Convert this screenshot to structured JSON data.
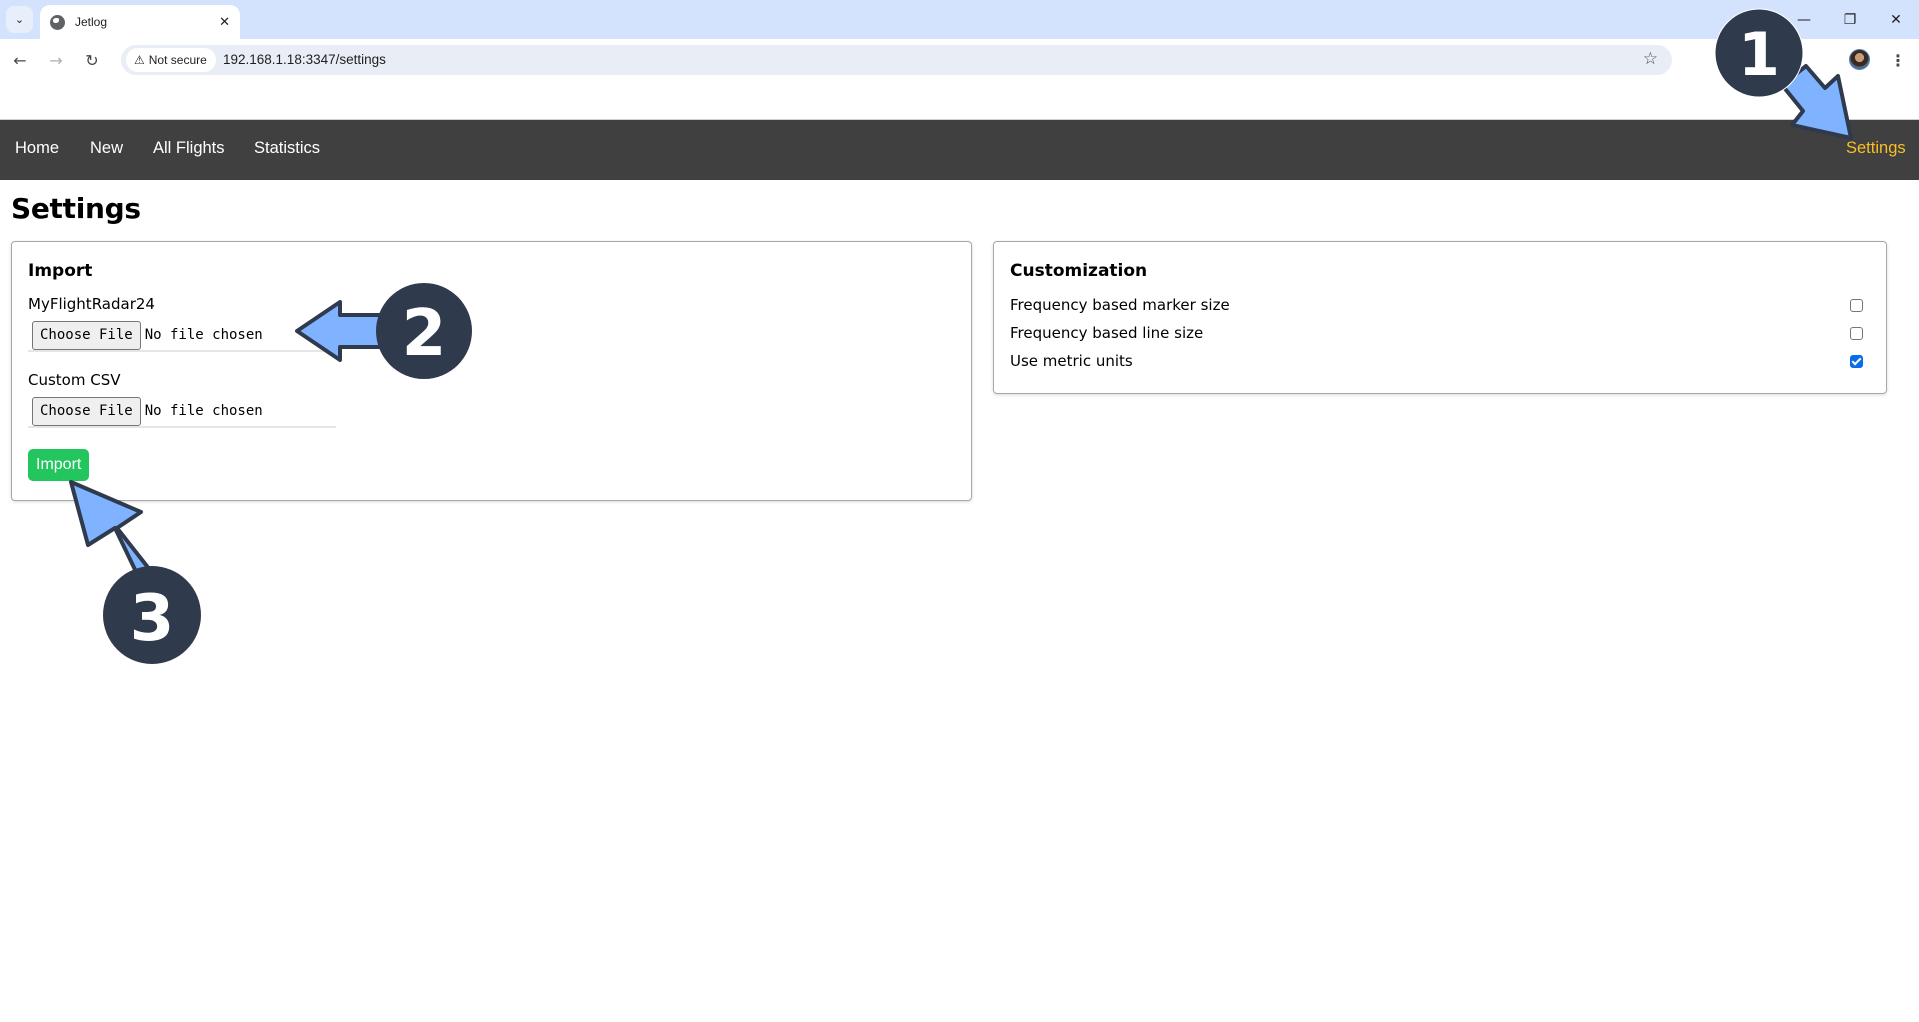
{
  "browser": {
    "tab_title": "Jetlog",
    "security_label": "Not secure",
    "url": "192.168.1.18:3347/settings",
    "icons": {
      "tab_list": "chevron-down-icon",
      "favicon": "globe-icon",
      "tab_close": "close-icon",
      "back": "arrow-left-icon",
      "forward": "arrow-right-icon",
      "reload": "reload-icon",
      "warning": "warning-triangle-icon",
      "bookmark": "star-outline-icon",
      "profile": "avatar-icon",
      "menu": "kebab-menu-icon",
      "minimize": "minimize-icon",
      "restore": "restore-icon",
      "close_window": "close-icon"
    },
    "glyphs": {
      "tab_list": "⌄",
      "tab_close": "✕",
      "back": "←",
      "forward": "→",
      "reload": "↻",
      "warning": "⚠",
      "bookmark": "☆",
      "menu": "⋮",
      "minimize": "—",
      "restore": "❐",
      "close_window": "✕"
    }
  },
  "nav": {
    "items": [
      {
        "label": "Home"
      },
      {
        "label": "New"
      },
      {
        "label": "All Flights"
      },
      {
        "label": "Statistics"
      }
    ],
    "settings_label": "Settings",
    "active_color": "#fbbf24"
  },
  "page": {
    "title": "Settings"
  },
  "import_panel": {
    "heading": "Import",
    "fields": [
      {
        "label": "MyFlightRadar24",
        "button": "Choose File",
        "status": "No file chosen"
      },
      {
        "label": "Custom CSV",
        "button": "Choose File",
        "status": "No file chosen"
      }
    ],
    "submit_label": "Import",
    "submit_color": "#22c55e"
  },
  "customization_panel": {
    "heading": "Customization",
    "options": [
      {
        "label": "Frequency based marker size",
        "checked": false
      },
      {
        "label": "Frequency based line size",
        "checked": false
      },
      {
        "label": "Use metric units",
        "checked": true
      }
    ]
  },
  "annotations": [
    {
      "number": "1",
      "target": "Settings nav link"
    },
    {
      "number": "2",
      "target": "MyFlightRadar24 file input"
    },
    {
      "number": "3",
      "target": "Import button"
    }
  ],
  "colors": {
    "navbar_bg": "#404040",
    "badge_fill": "#2f3a4d",
    "arrow_fill": "#7fb2ff"
  }
}
